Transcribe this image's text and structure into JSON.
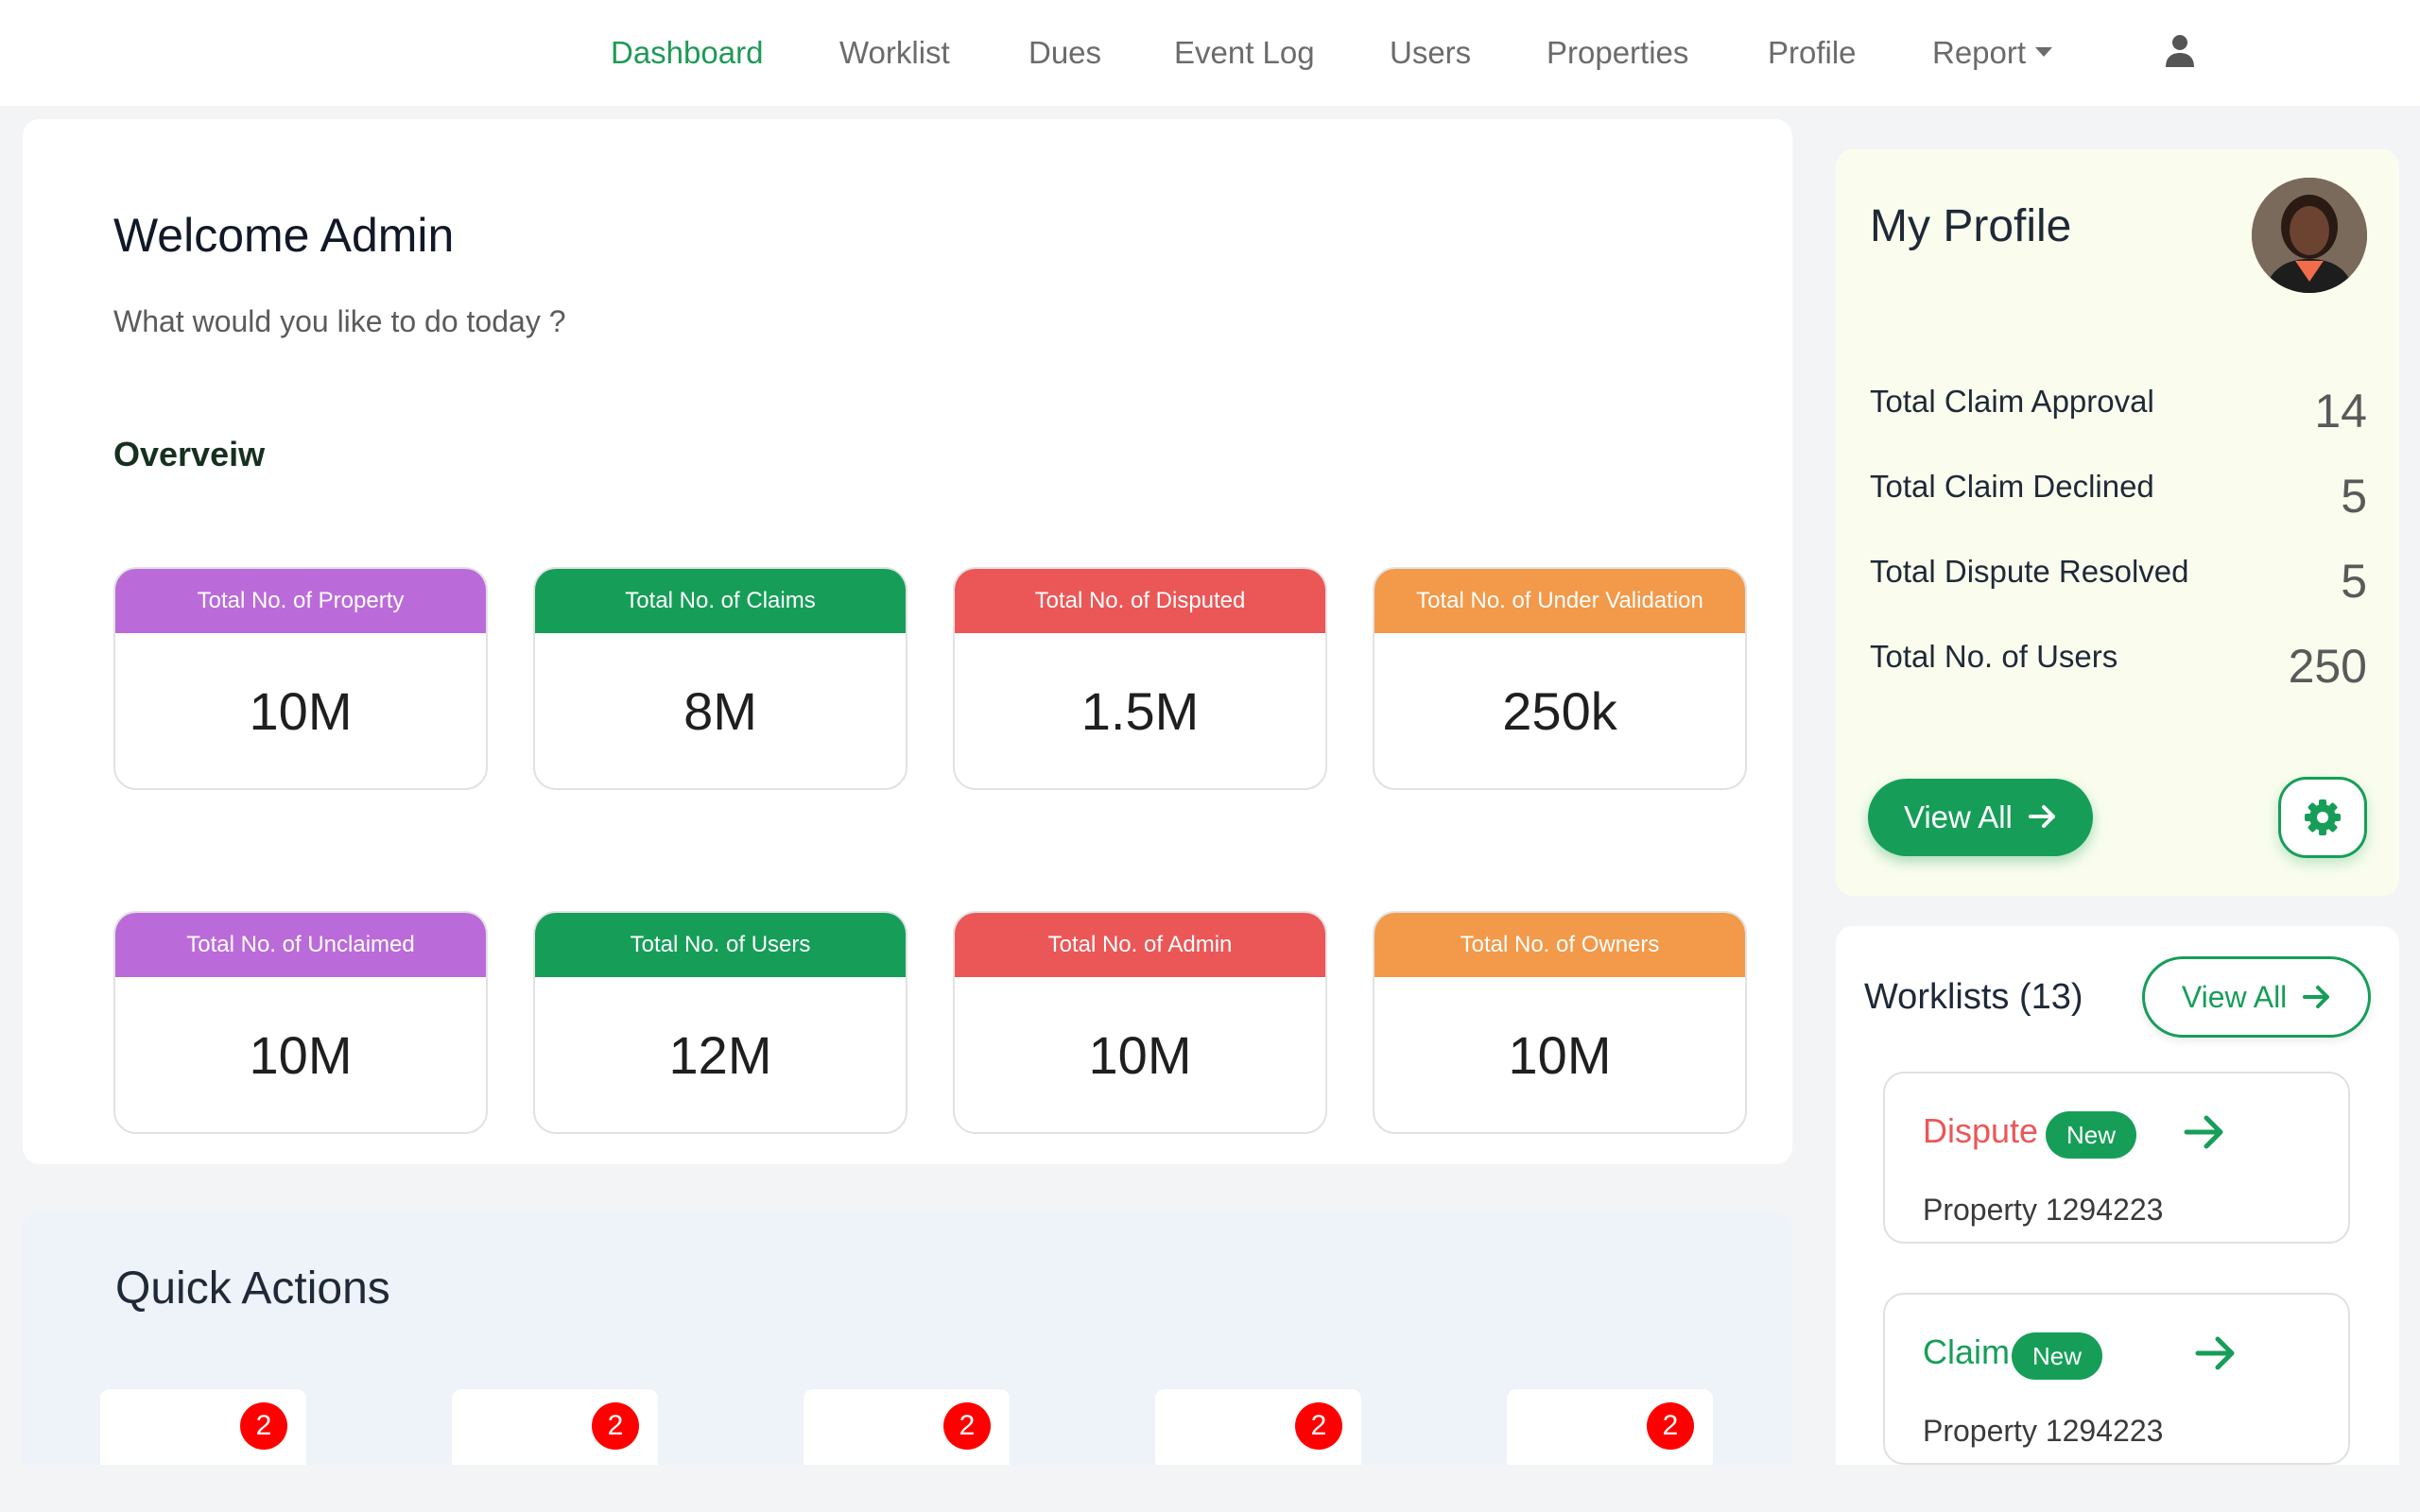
{
  "nav": {
    "items": [
      "Dashboard",
      "Worklist",
      "Dues",
      "Event Log",
      "Users",
      "Properties",
      "Profile"
    ],
    "report_label": "Report",
    "active": "Dashboard",
    "user_icon": "user-icon"
  },
  "main": {
    "welcome_title": "Welcome Admin",
    "welcome_subtitle": "What would you like to do today ?",
    "overview_title": "Overveiw",
    "stats": [
      {
        "label": "Total No. of Property",
        "value": "10M",
        "color": "#bb6bd9"
      },
      {
        "label": "Total No. of Claims",
        "value": "8M",
        "color": "#169e58"
      },
      {
        "label": "Total No. of Disputed",
        "value": "1.5M",
        "color": "#eb5757"
      },
      {
        "label": "Total No. of Under Validation",
        "value": "250k",
        "color": "#f2994a"
      },
      {
        "label": "Total No. of Unclaimed",
        "value": "10M",
        "color": "#bb6bd9"
      },
      {
        "label": "Total No. of Users",
        "value": "12M",
        "color": "#169e58"
      },
      {
        "label": "Total No. of Admin",
        "value": "10M",
        "color": "#eb5757"
      },
      {
        "label": "Total No. of Owners",
        "value": "10M",
        "color": "#f2994a"
      }
    ]
  },
  "quick_actions": {
    "title": "Quick Actions",
    "badges": [
      "2",
      "2",
      "2",
      "2",
      "2"
    ]
  },
  "profile": {
    "title": "My Profile",
    "rows": [
      {
        "label": "Total Claim Approval",
        "value": "14"
      },
      {
        "label": "Total Claim Declined",
        "value": "5"
      },
      {
        "label": "Total Dispute Resolved",
        "value": "5"
      },
      {
        "label": "Total No. of Users",
        "value": "250"
      }
    ],
    "view_all_label": "View All",
    "settings_icon": "gear-icon"
  },
  "worklists": {
    "title": "Worklists (13)",
    "view_all_label": "View All",
    "items": [
      {
        "type": "Dispute",
        "badge": "New",
        "property": "Property 1294223"
      },
      {
        "type": "Claim",
        "badge": "New",
        "property": "Property 1294223"
      }
    ]
  },
  "colors": {
    "accent": "#169e58",
    "purple": "#bb6bd9",
    "red": "#eb5757",
    "orange": "#f2994a",
    "badge_red": "#ff0000"
  }
}
